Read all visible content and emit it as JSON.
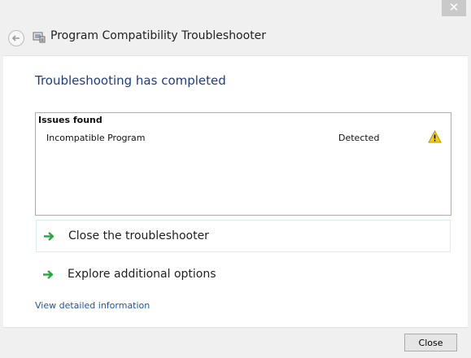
{
  "window": {
    "close_glyph": "✕",
    "title": "Program Compatibility Troubleshooter"
  },
  "main": {
    "headline": "Troubleshooting has completed",
    "issues": {
      "heading": "Issues found",
      "rows": [
        {
          "name": "Incompatible Program",
          "status": "Detected",
          "icon": "warning-icon"
        }
      ]
    },
    "options": [
      {
        "label": "Close the troubleshooter",
        "icon": "green-arrow-icon"
      },
      {
        "label": "Explore additional options",
        "icon": "green-arrow-icon"
      }
    ],
    "details_link": "View detailed information"
  },
  "footer": {
    "close_label": "Close"
  },
  "colors": {
    "headline": "#1e3c8c",
    "link": "#1e57a5",
    "arrow": "#2aa844",
    "warning": "#f5d000"
  }
}
